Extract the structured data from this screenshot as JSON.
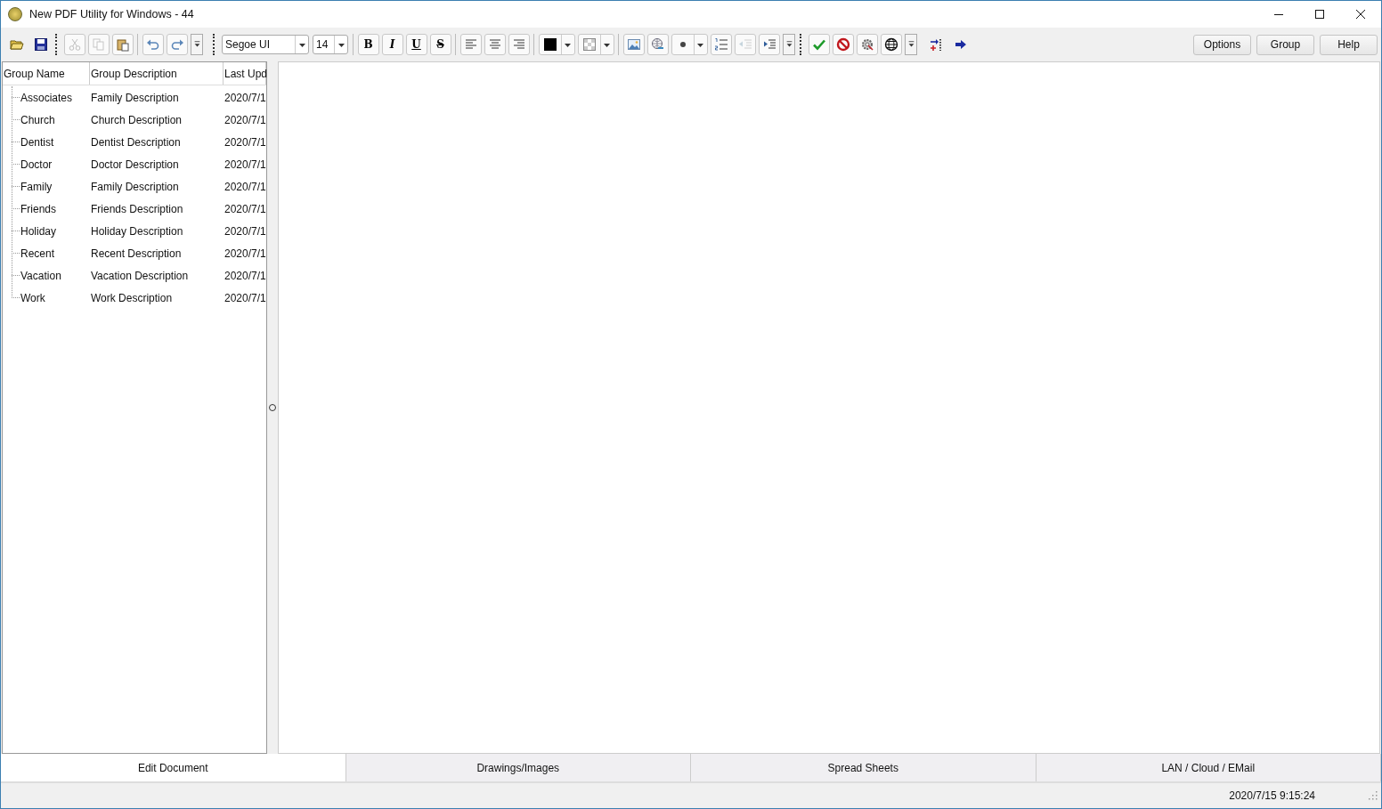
{
  "window": {
    "title": "New PDF Utility for Windows - 44"
  },
  "toolbar": {
    "items": [
      {
        "kind": "open",
        "disabled": false
      },
      {
        "kind": "save",
        "disabled": false
      },
      {
        "kind": "grip"
      },
      {
        "kind": "cut",
        "disabled": true
      },
      {
        "kind": "copy",
        "disabled": true
      },
      {
        "kind": "paste",
        "disabled": false
      },
      {
        "kind": "sep"
      },
      {
        "kind": "undo",
        "disabled": false
      },
      {
        "kind": "redo",
        "disabled": false
      },
      {
        "kind": "overflow"
      },
      {
        "kind": "gap"
      },
      {
        "kind": "grip"
      },
      {
        "kind": "font",
        "value": "Segoe UI"
      },
      {
        "kind": "size",
        "value": "14"
      },
      {
        "kind": "sep"
      },
      {
        "kind": "bold",
        "label": "B",
        "disabled": false
      },
      {
        "kind": "italic",
        "label": "I",
        "disabled": false
      },
      {
        "kind": "underline",
        "label": "U",
        "disabled": false
      },
      {
        "kind": "strike",
        "label": "S",
        "disabled": false
      },
      {
        "kind": "sep"
      },
      {
        "kind": "align-left",
        "disabled": false
      },
      {
        "kind": "align-center",
        "disabled": false
      },
      {
        "kind": "align-right",
        "disabled": false
      },
      {
        "kind": "sep"
      },
      {
        "kind": "color"
      },
      {
        "kind": "fill"
      },
      {
        "kind": "sep"
      },
      {
        "kind": "image",
        "disabled": false
      },
      {
        "kind": "link",
        "disabled": false
      },
      {
        "kind": "bullet"
      },
      {
        "kind": "numbered",
        "disabled": false
      },
      {
        "kind": "outdent",
        "disabled": true
      },
      {
        "kind": "indent",
        "disabled": false
      },
      {
        "kind": "overflow"
      },
      {
        "kind": "grip"
      },
      {
        "kind": "check",
        "disabled": false
      },
      {
        "kind": "stop",
        "disabled": false
      },
      {
        "kind": "gear",
        "disabled": false
      },
      {
        "kind": "globe",
        "disabled": false
      },
      {
        "kind": "overflow"
      },
      {
        "kind": "gap"
      },
      {
        "kind": "split",
        "disabled": false
      },
      {
        "kind": "arrow",
        "disabled": false
      }
    ]
  },
  "buttons": [
    "Options",
    "Group",
    "Help"
  ],
  "table": {
    "columns": [
      "Group Name",
      "Group Description",
      "Last Upd"
    ],
    "rows": [
      {
        "name": "Associates",
        "description": "Family Description",
        "updated": "2020/7/1"
      },
      {
        "name": "Church",
        "description": "Church Description",
        "updated": "2020/7/1"
      },
      {
        "name": "Dentist",
        "description": "Dentist Description",
        "updated": "2020/7/1"
      },
      {
        "name": "Doctor",
        "description": "Doctor Description",
        "updated": "2020/7/1"
      },
      {
        "name": "Family",
        "description": "Family Description",
        "updated": "2020/7/1"
      },
      {
        "name": "Friends",
        "description": "Friends Description",
        "updated": "2020/7/1"
      },
      {
        "name": "Holiday",
        "description": "Holiday Description",
        "updated": "2020/7/1"
      },
      {
        "name": "Recent",
        "description": "Recent Description",
        "updated": "2020/7/1"
      },
      {
        "name": "Vacation",
        "description": "Vacation Description",
        "updated": "2020/7/1"
      },
      {
        "name": "Work",
        "description": "Work Description",
        "updated": "2020/7/1"
      }
    ]
  },
  "tabs": [
    {
      "label": "Edit Document",
      "selected": true
    },
    {
      "label": "Drawings/Images",
      "selected": false
    },
    {
      "label": "Spread Sheets",
      "selected": false
    },
    {
      "label": "LAN / Cloud / EMail",
      "selected": false
    }
  ],
  "status_bar": {
    "time": "2020/7/15 9:15:24"
  }
}
